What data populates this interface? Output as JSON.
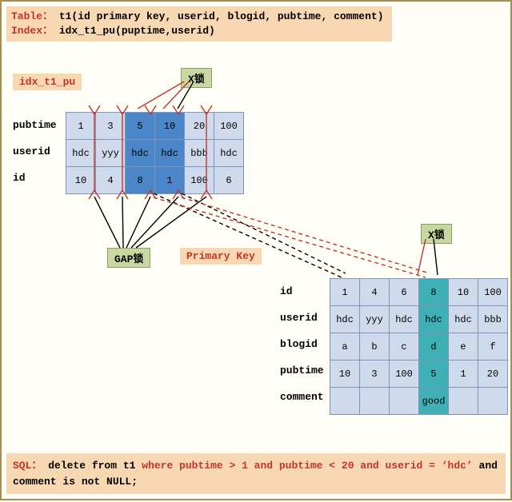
{
  "header": {
    "table_label": "Table：",
    "table_def": "t1(id primary key, userid, blogid, pubtime, comment)",
    "index_label": "Index：",
    "index_def": "idx_t1_pu(puptime,userid)"
  },
  "labels": {
    "idx_name": "idx_t1_pu",
    "xlock": "X锁",
    "gaplock": "GAP锁",
    "primary_key": "Primary Key"
  },
  "idx_table": {
    "row_headers": [
      "pubtime",
      "userid",
      "id"
    ],
    "rows": [
      [
        "1",
        "3",
        "5",
        "10",
        "20",
        "100"
      ],
      [
        "hdc",
        "yyy",
        "hdc",
        "hdc",
        "bbb",
        "hdc"
      ],
      [
        "10",
        "4",
        "8",
        "1",
        "100",
        "6"
      ]
    ],
    "highlight_cols": [
      2,
      3
    ]
  },
  "pk_table": {
    "row_headers": [
      "id",
      "userid",
      "blogid",
      "pubtime",
      "comment"
    ],
    "rows": [
      [
        "1",
        "4",
        "6",
        "8",
        "10",
        "100"
      ],
      [
        "hdc",
        "yyy",
        "hdc",
        "hdc",
        "hdc",
        "bbb"
      ],
      [
        "a",
        "b",
        "c",
        "d",
        "e",
        "f"
      ],
      [
        "10",
        "3",
        "100",
        "5",
        "1",
        "20"
      ],
      [
        "",
        "",
        "",
        "good",
        "",
        ""
      ]
    ],
    "highlight_cols": [
      3
    ]
  },
  "sql": {
    "prefix": "SQL：",
    "cmd": "delete from t1 ",
    "where": "where pubtime > 1 and pubtime < 20 and userid = ‘hdc’",
    "and_cmd": " and comment is not NULL;"
  }
}
